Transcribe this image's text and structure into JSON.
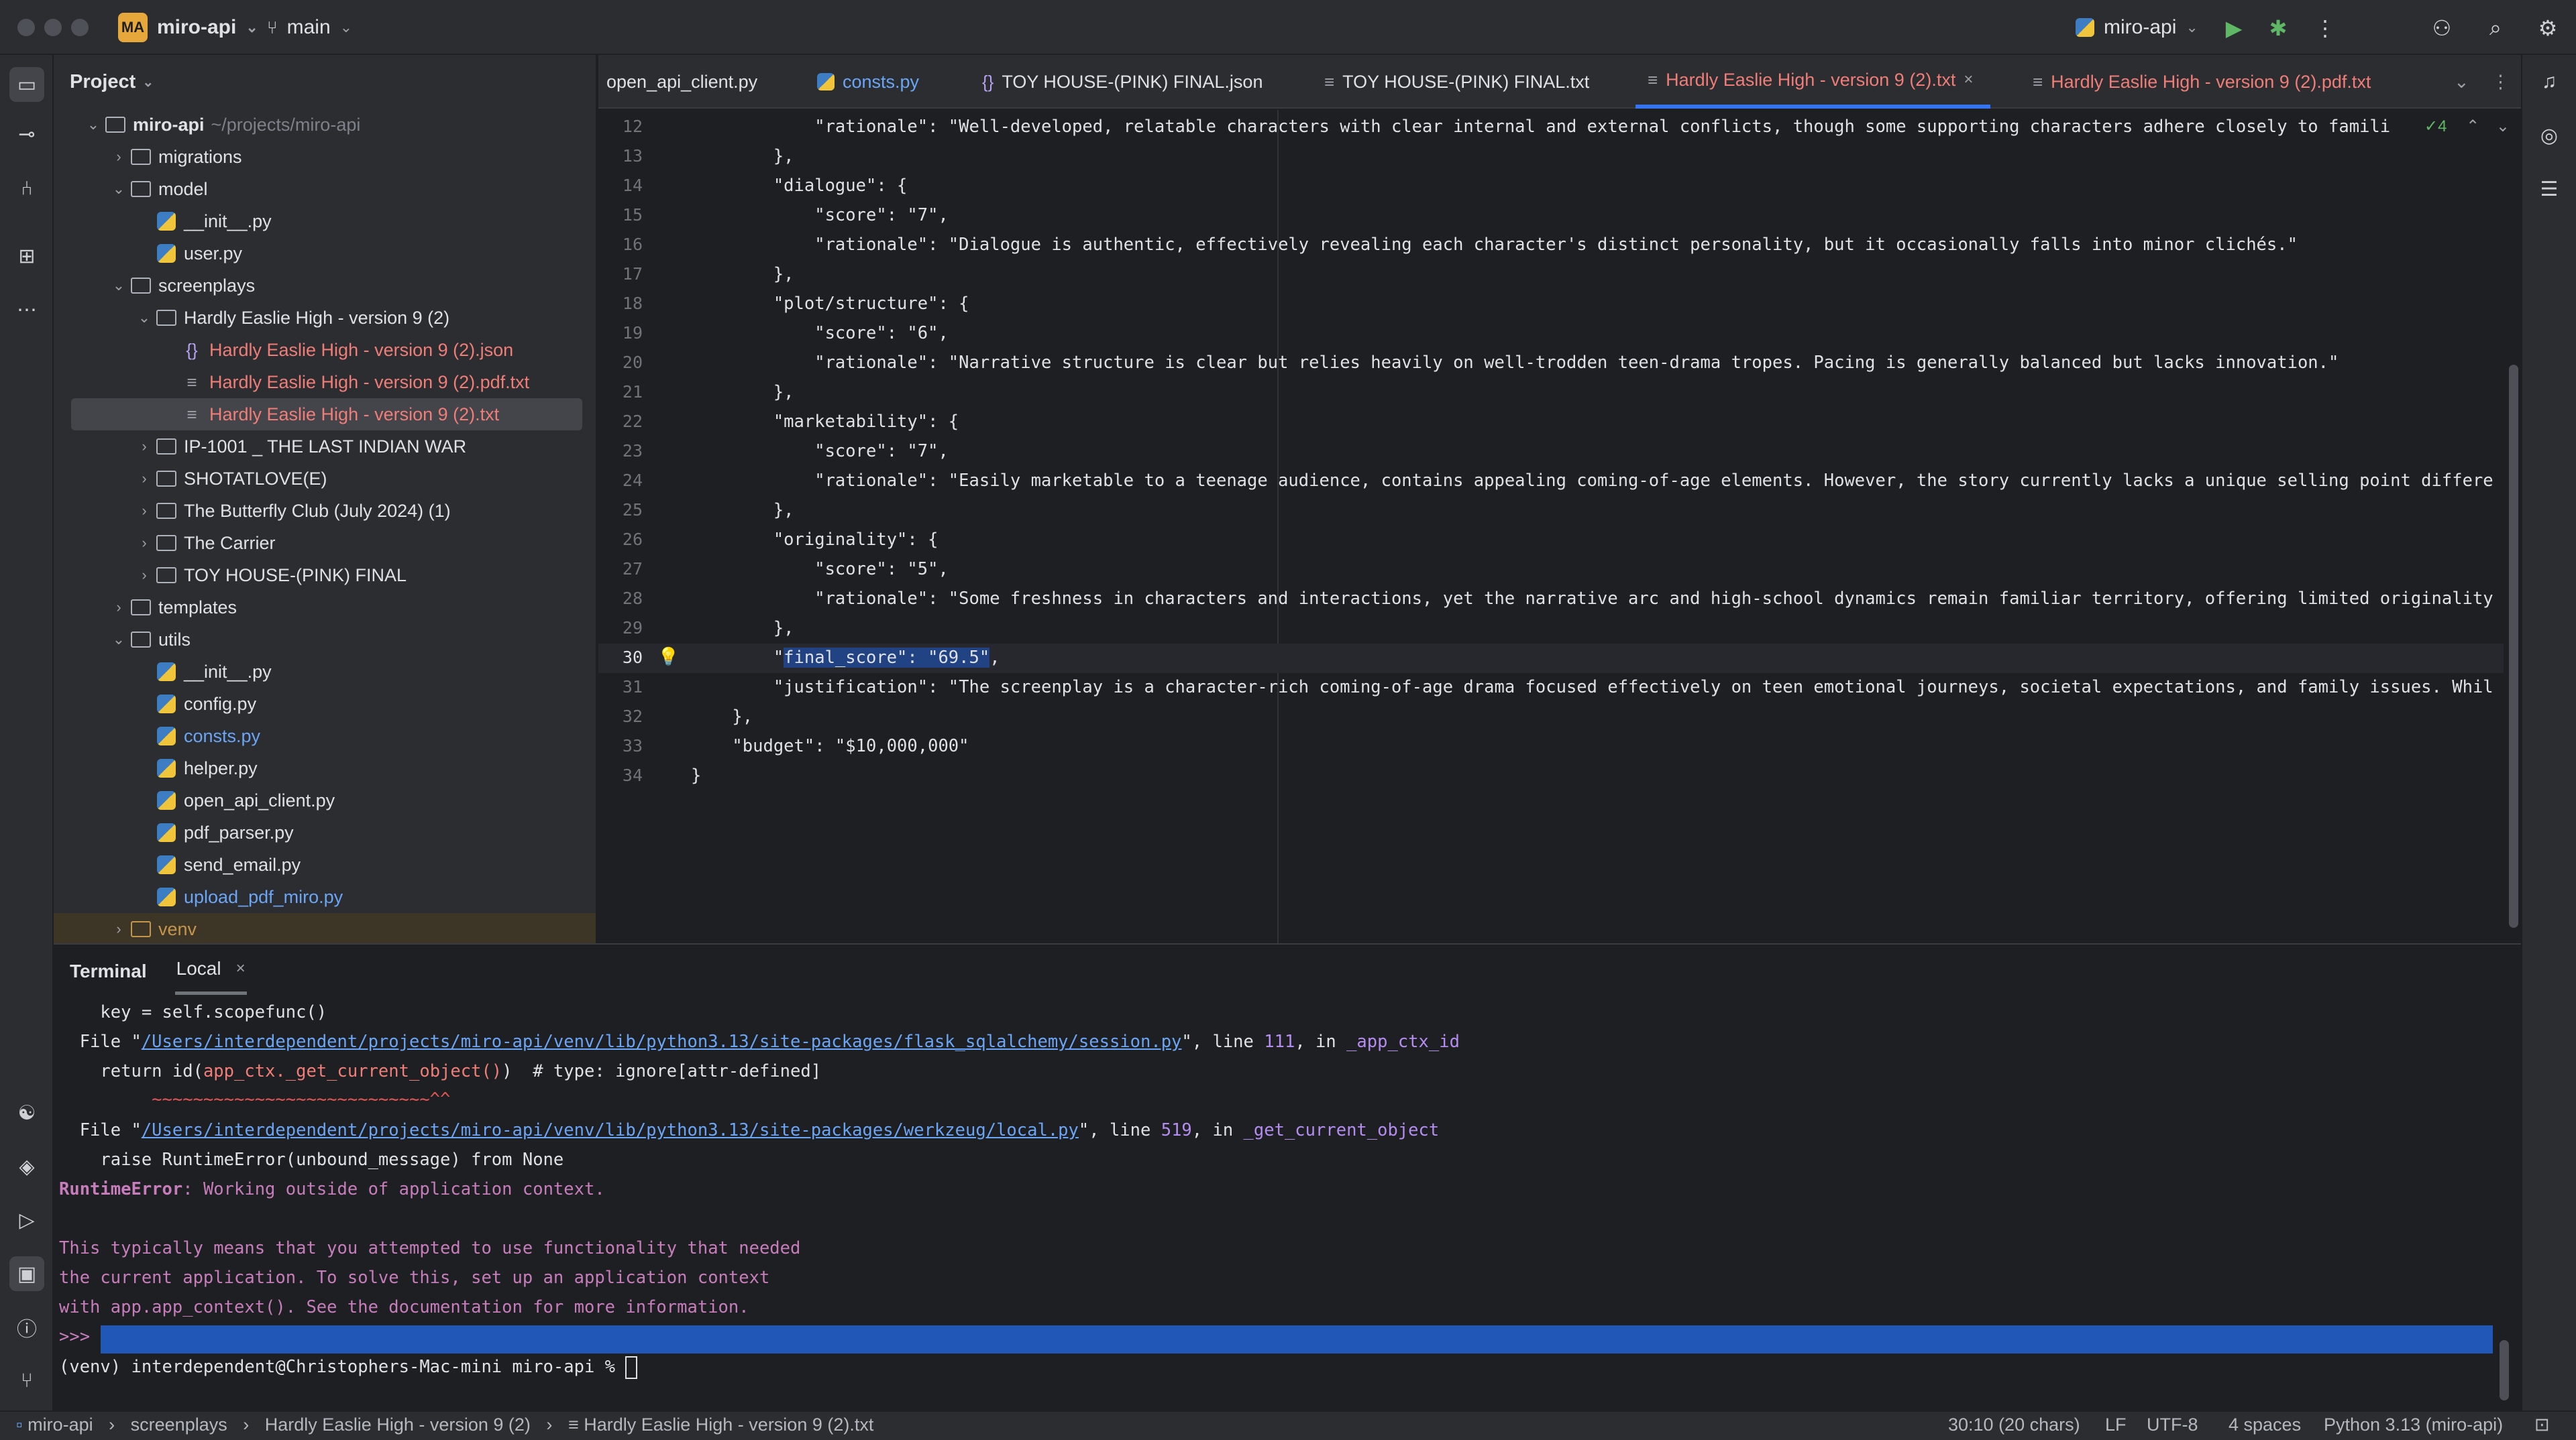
{
  "titlebar": {
    "project_badge": "MA",
    "project_name": "miro-api",
    "branch": "main",
    "run_config": "miro-api"
  },
  "project_panel": {
    "title": "Project",
    "tree": [
      {
        "label": "miro-api",
        "hint": "~/projects/miro-api",
        "depth": 0,
        "kind": "folder",
        "expanded": true,
        "style": "bold"
      },
      {
        "label": "migrations",
        "depth": 1,
        "kind": "folder",
        "expanded": false
      },
      {
        "label": "model",
        "depth": 1,
        "kind": "folder",
        "expanded": true
      },
      {
        "label": "__init__.py",
        "depth": 2,
        "kind": "py"
      },
      {
        "label": "user.py",
        "depth": 2,
        "kind": "py"
      },
      {
        "label": "screenplays",
        "depth": 1,
        "kind": "folder",
        "expanded": true
      },
      {
        "label": "Hardly Easlie High - version 9 (2)",
        "depth": 2,
        "kind": "folder",
        "expanded": true
      },
      {
        "label": "Hardly Easlie High - version 9 (2).json",
        "depth": 3,
        "kind": "json",
        "style": "err"
      },
      {
        "label": "Hardly Easlie High - version 9 (2).pdf.txt",
        "depth": 3,
        "kind": "txt",
        "style": "err"
      },
      {
        "label": "Hardly Easlie High - version 9 (2).txt",
        "depth": 3,
        "kind": "txt",
        "style": "err",
        "selected": true
      },
      {
        "label": "IP-1001 _ THE LAST INDIAN WAR",
        "depth": 2,
        "kind": "folder",
        "expanded": false
      },
      {
        "label": "SHOTATLOVE(E)",
        "depth": 2,
        "kind": "folder",
        "expanded": false
      },
      {
        "label": "The Butterfly Club (July 2024) (1)",
        "depth": 2,
        "kind": "folder",
        "expanded": false
      },
      {
        "label": "The Carrier",
        "depth": 2,
        "kind": "folder",
        "expanded": false
      },
      {
        "label": "TOY HOUSE-(PINK) FINAL",
        "depth": 2,
        "kind": "folder",
        "expanded": false
      },
      {
        "label": "templates",
        "depth": 1,
        "kind": "folder",
        "expanded": false
      },
      {
        "label": "utils",
        "depth": 1,
        "kind": "folder",
        "expanded": true
      },
      {
        "label": "__init__.py",
        "depth": 2,
        "kind": "py"
      },
      {
        "label": "config.py",
        "depth": 2,
        "kind": "py"
      },
      {
        "label": "consts.py",
        "depth": 2,
        "kind": "py",
        "style": "mod"
      },
      {
        "label": "helper.py",
        "depth": 2,
        "kind": "py"
      },
      {
        "label": "open_api_client.py",
        "depth": 2,
        "kind": "py"
      },
      {
        "label": "pdf_parser.py",
        "depth": 2,
        "kind": "py"
      },
      {
        "label": "send_email.py",
        "depth": 2,
        "kind": "py"
      },
      {
        "label": "upload_pdf_miro.py",
        "depth": 2,
        "kind": "py",
        "style": "mod"
      },
      {
        "label": "venv",
        "depth": 1,
        "kind": "folder",
        "expanded": false,
        "style": "venv"
      }
    ]
  },
  "tabs": [
    {
      "label": "open_api_client.py",
      "icon": "python-icon",
      "active": false
    },
    {
      "label": "consts.py",
      "icon": "python-icon",
      "active": false,
      "style": "mod"
    },
    {
      "label": "TOY HOUSE-(PINK) FINAL.json",
      "icon": "json-icon",
      "active": false
    },
    {
      "label": "TOY HOUSE-(PINK) FINAL.txt",
      "icon": "text-file-icon",
      "active": false
    },
    {
      "label": "Hardly Easlie High - version 9 (2).txt",
      "icon": "text-file-icon",
      "active": true
    },
    {
      "label": "Hardly Easlie High - version 9 (2).pdf.txt",
      "icon": "text-file-icon",
      "active": false,
      "style": "err"
    }
  ],
  "editor": {
    "inspection_count": "4",
    "lines": [
      {
        "n": "12",
        "text": "            \"rationale\": \"Well-developed, relatable characters with clear internal and external conflicts, though some supporting characters adhere closely to famili"
      },
      {
        "n": "13",
        "text": "        },"
      },
      {
        "n": "14",
        "text": "        \"dialogue\": {"
      },
      {
        "n": "15",
        "text": "            \"score\": \"7\","
      },
      {
        "n": "16",
        "text": "            \"rationale\": \"Dialogue is authentic, effectively revealing each character's distinct personality, but it occasionally falls into minor clichés.\""
      },
      {
        "n": "17",
        "text": "        },"
      },
      {
        "n": "18",
        "text": "        \"plot/structure\": {"
      },
      {
        "n": "19",
        "text": "            \"score\": \"6\","
      },
      {
        "n": "20",
        "text": "            \"rationale\": \"Narrative structure is clear but relies heavily on well-trodden teen-drama tropes. Pacing is generally balanced but lacks innovation.\""
      },
      {
        "n": "21",
        "text": "        },"
      },
      {
        "n": "22",
        "text": "        \"marketability\": {"
      },
      {
        "n": "23",
        "text": "            \"score\": \"7\","
      },
      {
        "n": "24",
        "text": "            \"rationale\": \"Easily marketable to a teenage audience, contains appealing coming-of-age elements. However, the story currently lacks a unique selling point differe"
      },
      {
        "n": "25",
        "text": "        },"
      },
      {
        "n": "26",
        "text": "        \"originality\": {"
      },
      {
        "n": "27",
        "text": "            \"score\": \"5\","
      },
      {
        "n": "28",
        "text": "            \"rationale\": \"Some freshness in characters and interactions, yet the narrative arc and high-school dynamics remain familiar territory, offering limited originality"
      },
      {
        "n": "29",
        "text": "        },"
      },
      {
        "n": "30",
        "pre": "        \"",
        "sel": "final_score\": \"69.5\"",
        "post": ",",
        "current": true
      },
      {
        "n": "31",
        "text": "        \"justification\": \"The screenplay is a character-rich coming-of-age drama focused effectively on teen emotional journeys, societal expectations, and family issues. Whil"
      },
      {
        "n": "32",
        "text": "    },"
      },
      {
        "n": "33",
        "text": "    \"budget\": \"$10,000,000\""
      },
      {
        "n": "34",
        "text": "}"
      }
    ]
  },
  "terminal": {
    "tab_title": "Terminal",
    "session_tab": "Local",
    "lines": {
      "l1": "    key = self.scopefunc()",
      "l2_pre": "  File \"",
      "l2_link": "/Users/interdependent/projects/miro-api/venv/lib/python3.13/site-packages/flask_sqlalchemy/session.py",
      "l2_mid": "\", line ",
      "l2_num": "111",
      "l2_in": ", in ",
      "l2_fn": "_app_ctx_id",
      "l3_pre": "    return id(",
      "l3_call": "app_ctx._get_current_object()",
      "l3_post": ")  # type: ignore[attr-defined]",
      "l4": "         ~~~~~~~~~~~~~~~~~~~~~~~~~~~^^",
      "l5_pre": "  File \"",
      "l5_link": "/Users/interdependent/projects/miro-api/venv/lib/python3.13/site-packages/werkzeug/local.py",
      "l5_mid": "\", line ",
      "l5_num": "519",
      "l5_in": ", in ",
      "l5_fn": "_get_current_object",
      "l6": "    raise RuntimeError(unbound_message) from None",
      "l7_err": "RuntimeError",
      "l7_msg": ": Working outside of application context.",
      "l8": "This typically means that you attempted to use functionality that needed",
      "l9": "the current application. To solve this, set up an application context",
      "l10": "with app.app_context(). See the documentation for more information.",
      "l11": ">>>",
      "l12": "(venv) interdependent@Christophers-Mac-mini miro-api % "
    }
  },
  "statusbar": {
    "breadcrumb": [
      "miro-api",
      "screenplays",
      "Hardly Easlie High - version 9 (2)",
      "Hardly Easlie High - version 9 (2).txt"
    ],
    "position": "30:10 (20 chars)",
    "line_sep": "LF",
    "encoding": "UTF-8",
    "indent": "4 spaces",
    "interpreter": "Python 3.13 (miro-api)"
  }
}
